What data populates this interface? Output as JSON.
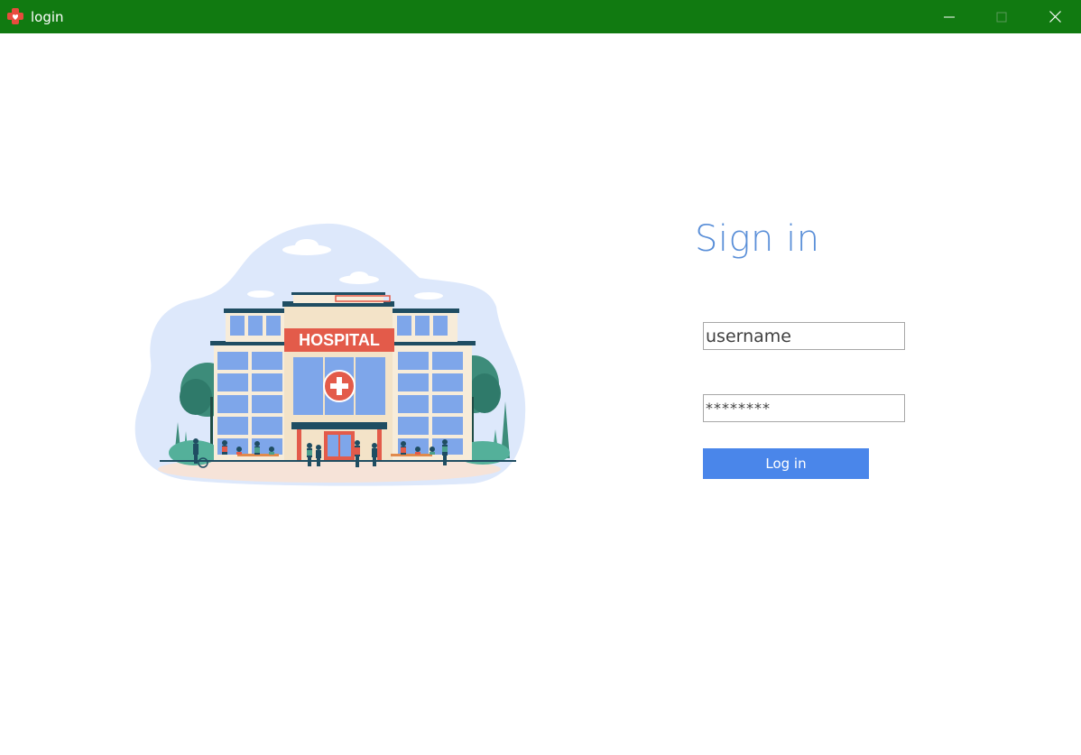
{
  "window": {
    "title": "login",
    "controls": [
      "minimize",
      "maximize",
      "close"
    ]
  },
  "illustration": {
    "sign_text": "HOSPITAL"
  },
  "form": {
    "heading": "Sign in",
    "username_value": "username",
    "password_value": "********",
    "login_label": "Log in"
  },
  "colors": {
    "titlebar": "#117a11",
    "heading": "#5a8fd8",
    "button": "#4a86ea"
  }
}
